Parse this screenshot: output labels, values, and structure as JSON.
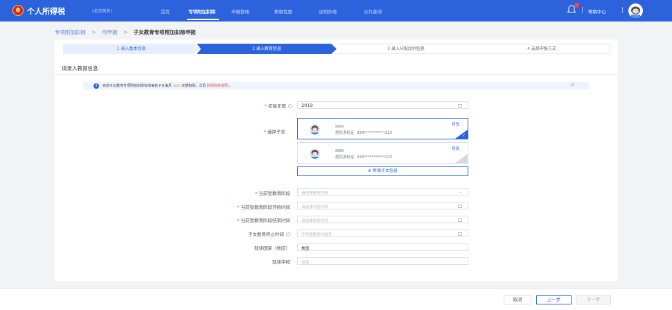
{
  "header": {
    "brand": "个人所得税",
    "brand_sub": "(北京税务)",
    "nav": [
      "首页",
      "专项附加扣除",
      "申报管理",
      "税收优惠",
      "证明办理",
      "公共查询"
    ],
    "help": "帮助中心"
  },
  "breadcrumb": {
    "items": [
      "专项附加扣除",
      "可申报",
      "子女教育专项附加扣除申报"
    ],
    "separator": ">"
  },
  "steps": [
    "1 录入基本信息",
    "2 录入教育信息",
    "3 录入分配比例信息",
    "4 选择申报方式"
  ],
  "section_title": "请录入教育信息",
  "notice": {
    "prefix": "目前子女教育专项附加扣除标准每名子女每月",
    "amount": "xx元",
    "middle": "定额扣除，详见",
    "link": "扣除标准说明",
    "suffix": "。",
    "close": "✕"
  },
  "form": {
    "year": {
      "label": "扣除年度",
      "value": "2019"
    },
    "child": {
      "label": "选择子女",
      "children": [
        {
          "id_label": "居民身份证",
          "id_value": "339***********22X",
          "edit": "修改"
        },
        {
          "id_label": "居民身份证",
          "id_value": "339***********22X",
          "edit": "修改"
        }
      ],
      "add": "新增子女信息"
    },
    "stage": {
      "label": "当前受教育阶段",
      "placeholder": "请选择教育阶段"
    },
    "start": {
      "label": "当前受教育阶段开始时间",
      "placeholder": "请选择开始时间"
    },
    "end": {
      "label": "当前受教育阶段结束时间",
      "placeholder": "请选择结束时间"
    },
    "stop": {
      "label": "子女教育终止时间",
      "placeholder": "不再受教育时填写"
    },
    "country": {
      "label": "就读国家（地区）",
      "value": "美国"
    },
    "school": {
      "label": "就读学校",
      "placeholder": "选填"
    }
  },
  "footer": {
    "cancel": "取消",
    "prev": "上一步",
    "next": "下一步"
  },
  "colors": {
    "primary": "#2c63dd",
    "required": "#f04b4b",
    "amount": "#ef8a36"
  }
}
